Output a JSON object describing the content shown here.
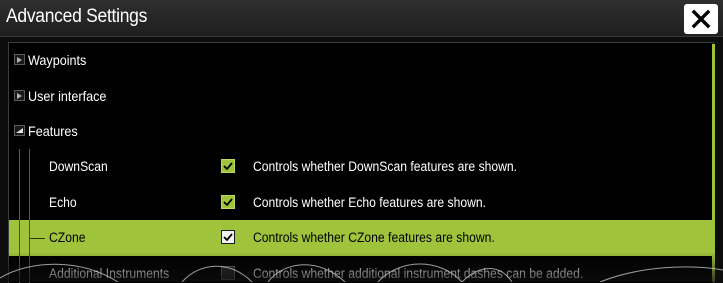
{
  "window": {
    "title": "Advanced Settings"
  },
  "tree": {
    "nodes": [
      {
        "label": "Waypoints",
        "expanded": false
      },
      {
        "label": "User interface",
        "expanded": false
      },
      {
        "label": "Features",
        "expanded": true
      }
    ],
    "features": [
      {
        "name": "DownScan",
        "checked": true,
        "description": "Controls whether DownScan features are shown."
      },
      {
        "name": "Echo",
        "checked": true,
        "description": "Controls whether Echo features are shown."
      },
      {
        "name": "CZone",
        "checked": true,
        "selected": true,
        "description": "Controls whether CZone features are shown."
      },
      {
        "name": "Additional Instruments",
        "checked": false,
        "description": "Controls whether additional instrument dashes can be added."
      }
    ]
  },
  "colors": {
    "accent": "#9fc43c",
    "background": "#000000",
    "titlebar": "#262626"
  },
  "icons": {
    "close": "close-icon",
    "collapsed": "triangle-right-icon",
    "expanded": "triangle-down-icon",
    "check": "checkmark-icon"
  }
}
